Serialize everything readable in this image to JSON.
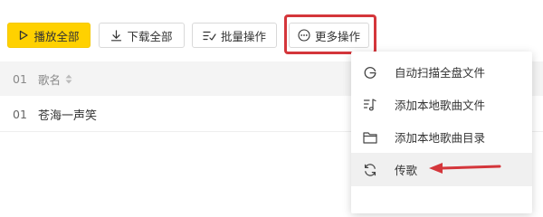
{
  "toolbar": {
    "play_all": "播放全部",
    "download_all": "下载全部",
    "batch_ops": "批量操作",
    "more_ops": "更多操作"
  },
  "table": {
    "header_index": "01",
    "header_name": "歌名",
    "rows": [
      {
        "index": "01",
        "name": "苍海一声笑"
      }
    ]
  },
  "menu": {
    "items": [
      {
        "label": "自动扫描全盘文件",
        "icon": "scan-icon"
      },
      {
        "label": "添加本地歌曲文件",
        "icon": "music-file-icon"
      },
      {
        "label": "添加本地歌曲目录",
        "icon": "folder-icon"
      },
      {
        "label": "传歌",
        "icon": "sync-icon"
      }
    ]
  },
  "colors": {
    "accent": "#ffd100",
    "highlight": "#d4363b"
  }
}
